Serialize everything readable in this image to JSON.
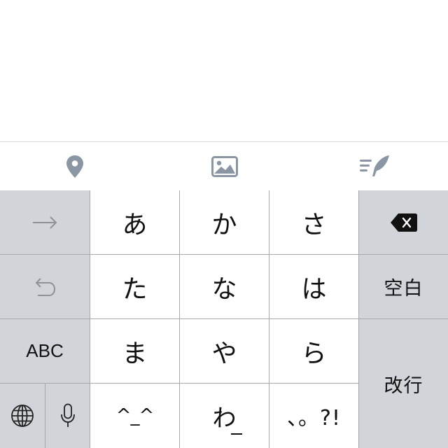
{
  "toolbar": {
    "icons": [
      "location-pin-icon",
      "photo-icon",
      "text-style-quill-icon"
    ],
    "icon_color": "#8a96a3"
  },
  "keyboard": {
    "colors": {
      "white_key": "#ffffff",
      "gray_key": "#d1d4d9",
      "separator": "#a7a9ae",
      "text": "#111111"
    },
    "left_column": {
      "next_icon": "right-arrow-icon",
      "undo_icon": "undo-arrow-icon",
      "abc_label": "ABC",
      "globe_icon": "globe-icon",
      "mic_icon": "microphone-icon"
    },
    "kana": {
      "a": "あ",
      "ka": "か",
      "sa": "さ",
      "ta": "た",
      "na": "な",
      "ha": "は",
      "ma": "ま",
      "ya": "や",
      "ra": "ら",
      "emoticon": "^_^",
      "wa": "わ",
      "punct": "、。?!"
    },
    "right_column": {
      "delete_icon": "backspace-icon",
      "space_label": "空白",
      "return_label": "改行"
    }
  }
}
